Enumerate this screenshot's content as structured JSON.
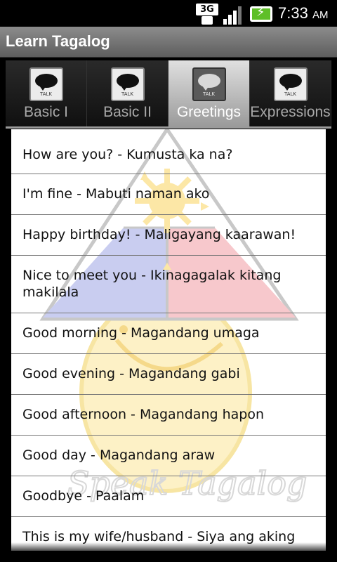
{
  "status_bar": {
    "network": "3G",
    "time": "7:33",
    "ampm": "AM"
  },
  "app": {
    "title": "Learn Tagalog"
  },
  "tabs": [
    {
      "label": "Basic I",
      "icon": "talk-bubble-icon",
      "icon_text": "TALK",
      "selected": false
    },
    {
      "label": "Basic II",
      "icon": "talk-bubble-icon",
      "icon_text": "TALK",
      "selected": false
    },
    {
      "label": "Greetings",
      "icon": "talk-bubble-icon",
      "icon_text": "TALK",
      "selected": true
    },
    {
      "label": "Expressions",
      "icon": "talk-bubble-icon",
      "icon_text": "TALK",
      "selected": false
    }
  ],
  "phrases": [
    "How are you? - Kumusta ka na?",
    "I'm fine - Mabuti naman ako",
    "Happy birthday! - Maligayang kaarawan!",
    "Nice to meet you - Ikinagagalak kitang makilala",
    "Good morning - Magandang umaga",
    "Good evening - Magandang gabi",
    "Good afternoon - Magandang hapon",
    "Good day - Magandang araw",
    "Goodbye - Paalam",
    "This is my wife/husband - Siya ang aking"
  ],
  "watermark": {
    "text": "Speak Tagalog"
  },
  "colors": {
    "accent_tab_selected": "#bfbfbf",
    "flag_blue": "#b9bfeb",
    "flag_red": "#f5c0c4",
    "sun_yellow": "#fde9a4"
  }
}
